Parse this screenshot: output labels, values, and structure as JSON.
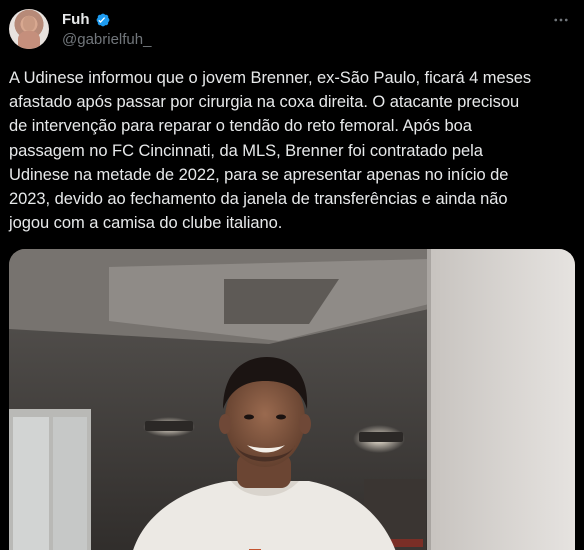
{
  "author": {
    "display_name": "Fuh",
    "handle": "@gabrielfuh_",
    "verified": true
  },
  "tweet": {
    "lines": [
      "A Udinese informou que o jovem Brenner, ex-São Paulo, ficará 4 meses",
      "afastado após passar por cirurgia na coxa direita. O atacante precisou",
      "de intervenção para reparar o tendão do reto femoral. Após boa",
      "passagem no FC Cincinnati, da MLS, Brenner foi contratado pela",
      "Udinese na metade de 2022, para se apresentar apenas no início de",
      "2023, devido ao fechamento da janela de transferências e ainda não",
      "jogou com a camisa do clube italiano."
    ]
  },
  "icons": {
    "verified": "verified-badge-icon",
    "more": "more-options-icon"
  },
  "colors": {
    "background": "#000000",
    "text_primary": "#e7e9ea",
    "text_secondary": "#71767b",
    "verified_blue": "#1d9bf0"
  }
}
